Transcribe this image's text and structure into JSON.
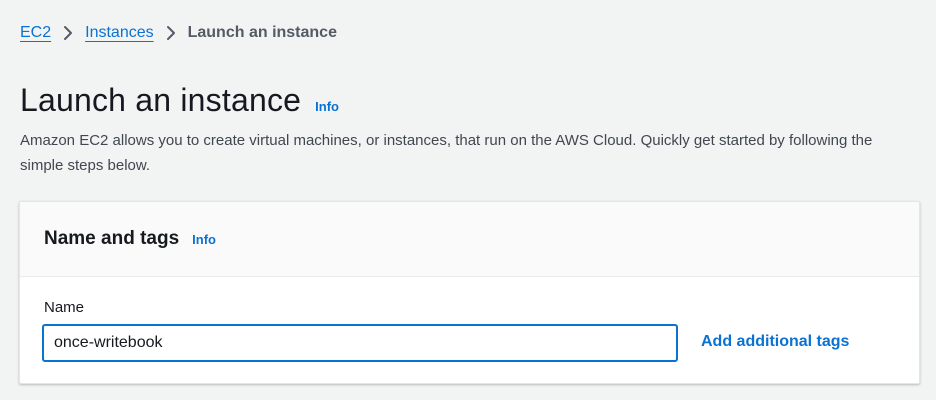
{
  "breadcrumb": {
    "items": [
      {
        "label": "EC2"
      },
      {
        "label": "Instances"
      },
      {
        "label": "Launch an instance"
      }
    ]
  },
  "page": {
    "title": "Launch an instance",
    "info_label": "Info",
    "description": "Amazon EC2 allows you to create virtual machines, or instances, that run on the AWS Cloud. Quickly get started by following the simple steps below."
  },
  "name_and_tags_panel": {
    "title": "Name and tags",
    "info_label": "Info",
    "name_field": {
      "label": "Name",
      "value": "once-writebook"
    },
    "add_tags_label": "Add additional tags"
  },
  "icons": {
    "breadcrumb_separator": "chevron-right-icon"
  },
  "colors": {
    "link": "#0972d3",
    "background": "#f2f3f3",
    "panel": "#ffffff",
    "input_focus_border": "#0972d3"
  }
}
